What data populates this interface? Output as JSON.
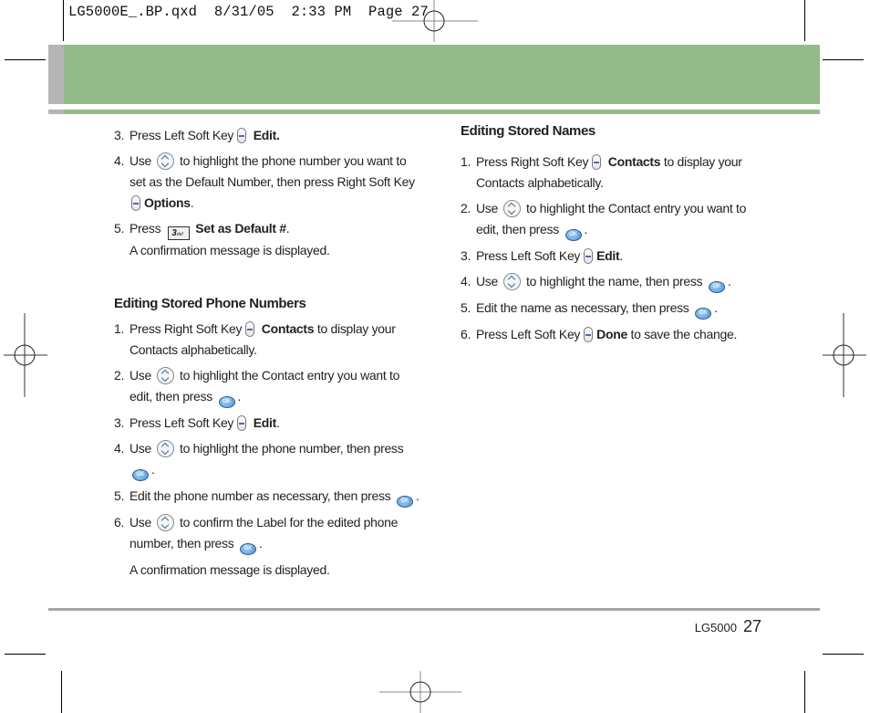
{
  "slug": "LG5000E_.BP.qxd  8/31/05  2:33 PM  Page 27",
  "icons": {
    "soft_key": "soft-key-icon",
    "nav_key": "nav-up-down-icon",
    "ok_key": "ok-key-icon",
    "key_3": "key-3-def-icon"
  },
  "colors": {
    "banner_green": "#93bb89",
    "banner_gray": "#b5b5b5",
    "footer_rule": "#a6a6a6",
    "text": "#231f20",
    "ok_blue": "#4b8fd3"
  },
  "ok_label": "OK",
  "key3_label": "3",
  "key3_sub": "def",
  "left": {
    "steps_a": [
      {
        "num": "3.",
        "pre": "Press Left Soft Key",
        "bold": "Edit."
      },
      {
        "num": "4.",
        "pre": "Use",
        "mid": "to highlight the phone number you want to set as the Default Number, then press Right Soft Key",
        "bold": "Options",
        "post": "."
      },
      {
        "num": "5.",
        "pre": "Press",
        "bold": "Set as Default #",
        "post": "."
      }
    ],
    "note_a": "A confirmation message is displayed.",
    "heading": "Editing Stored Phone Numbers",
    "steps_b": [
      {
        "num": "1.",
        "pre": "Press Right Soft Key",
        "bold": "Contacts",
        "post": "to display your Contacts alphabetically."
      },
      {
        "num": "2.",
        "pre": "Use",
        "post": "to highlight the Contact entry you want to edit, then press",
        "end": "."
      },
      {
        "num": "3.",
        "pre": "Press Left Soft Key",
        "bold": "Edit",
        "post": "."
      },
      {
        "num": "4.",
        "pre": "Use",
        "post": "to highlight the phone number, then press",
        "end": "."
      },
      {
        "num": "5.",
        "pre": "Edit the phone number as necessary, then press",
        "end": "."
      },
      {
        "num": "6.",
        "pre": "Use",
        "post": "to confirm the Label for the edited phone number, then press",
        "end": "."
      }
    ],
    "note_b": "A confirmation message is displayed."
  },
  "right": {
    "heading": "Editing Stored Names",
    "steps": [
      {
        "num": "1.",
        "pre": "Press Right Soft Key",
        "bold": "Contacts",
        "post": "to display your Contacts alphabetically."
      },
      {
        "num": "2.",
        "pre": "Use",
        "post": "to highlight the Contact entry you want to edit, then press",
        "end": "."
      },
      {
        "num": "3.",
        "pre": "Press Left Soft Key",
        "bold": "Edit",
        "post": "."
      },
      {
        "num": "4.",
        "pre": "Use",
        "post": "to highlight the name, then press",
        "end": "."
      },
      {
        "num": "5.",
        "pre": "Edit the name as necessary, then press",
        "end": "."
      },
      {
        "num": "6.",
        "pre": "Press Left Soft Key",
        "bold": "Done",
        "post": "to save the change."
      }
    ]
  },
  "footer": {
    "model": "LG5000",
    "page_number": "27"
  }
}
